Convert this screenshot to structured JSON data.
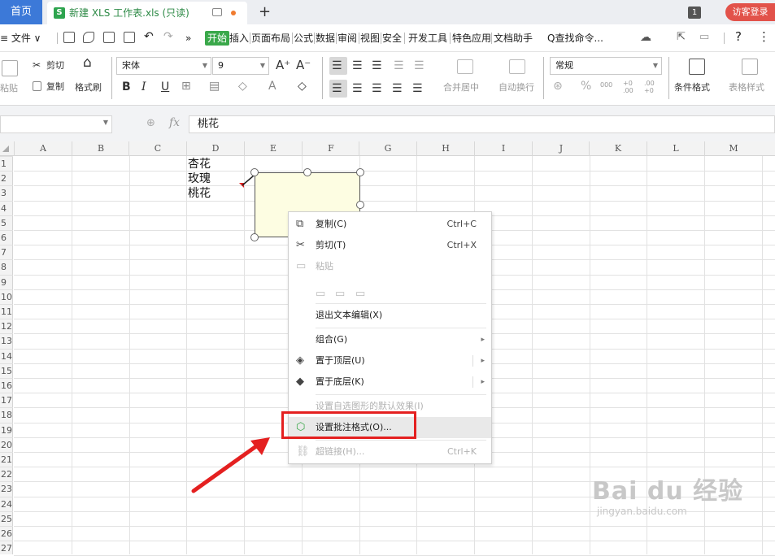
{
  "titlebar": {
    "home_tab": "首页",
    "doc_tab_icon": "S",
    "doc_tab_title": "新建 XLS 工作表.xls (只读)",
    "new_tab": "+",
    "window_count": "1",
    "login_button": "访客登录"
  },
  "menu": {
    "file": "≡ 文件 ∨",
    "more": "»",
    "items": [
      "开始",
      "插入",
      "页面布局",
      "公式",
      "数据",
      "审阅",
      "视图",
      "安全",
      "开发工具",
      "特色应用",
      "文档助手"
    ],
    "search": "Q查找命令...",
    "help": "?",
    "more_dots": "⋮"
  },
  "ribbon": {
    "paste": "粘贴",
    "cut": "剪切",
    "copy": "复制",
    "format_painter": "格式刷",
    "font_name": "宋体",
    "font_size": "9",
    "grow_font": "A⁺",
    "shrink_font": "A⁻",
    "bold": "B",
    "italic": "I",
    "underline": "U",
    "merge_center": "合并居中",
    "wrap_text": "自动换行",
    "number_format": "常规",
    "percent": "%",
    "thousands": "000",
    "inc_decimal": "+0 .00",
    "dec_decimal": ".00 +0",
    "conditional_format": "条件格式",
    "table_style": "表格样式"
  },
  "formula_bar": {
    "fx": "fx",
    "content": "桃花"
  },
  "grid": {
    "columns": [
      "A",
      "B",
      "C",
      "D",
      "E",
      "F",
      "G",
      "H",
      "I",
      "J",
      "K",
      "L",
      "M"
    ],
    "rows": [
      "1",
      "2",
      "3",
      "4",
      "5",
      "6",
      "7",
      "8",
      "9",
      "10",
      "11",
      "12",
      "13",
      "14",
      "15",
      "16",
      "17",
      "18",
      "19",
      "20",
      "21",
      "22",
      "23",
      "24",
      "25",
      "26",
      "27"
    ],
    "cell_d1": "杏花",
    "cell_d2": "玫瑰",
    "cell_d3": "桃花"
  },
  "context_menu": {
    "copy": {
      "label": "复制(C)",
      "shortcut": "Ctrl+C"
    },
    "cut": {
      "label": "剪切(T)",
      "shortcut": "Ctrl+X"
    },
    "paste": {
      "label": "粘贴"
    },
    "exit_text_edit": {
      "label": "退出文本编辑(X)"
    },
    "group": {
      "label": "组合(G)"
    },
    "bring_to_front": {
      "label": "置于顶层(U)"
    },
    "send_to_back": {
      "label": "置于底层(K)"
    },
    "set_default_effect": {
      "label": "设置自选图形的默认效果(I)"
    },
    "format_comment": {
      "label": "设置批注格式(O)..."
    },
    "hyperlink": {
      "label": "超链接(H)...",
      "shortcut": "Ctrl+K"
    }
  },
  "watermark": {
    "brand": "Bai du 经验",
    "url": "jingyan.baidu.com"
  },
  "colors": {
    "home_tab": "#3c79d8",
    "start_tab": "#3aa84a",
    "login": "#e2524a",
    "comment_fill": "#fdfde2",
    "highlight": "#e42020"
  }
}
